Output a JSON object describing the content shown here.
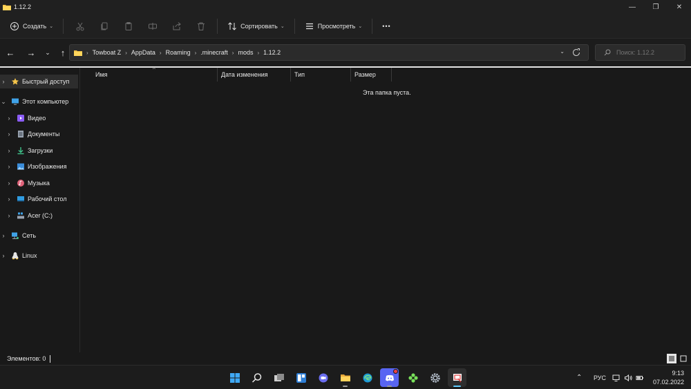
{
  "window": {
    "title": "1.12.2",
    "controls": {
      "minimize": "—",
      "maximize": "❐",
      "close": "✕"
    }
  },
  "commandbar": {
    "create_label": "Создать",
    "sort_label": "Сортировать",
    "view_label": "Просмотреть",
    "more_label": "•••",
    "icons": [
      "cut-icon",
      "copy-icon",
      "paste-icon",
      "rename-icon",
      "share-icon",
      "delete-icon"
    ]
  },
  "address": {
    "crumbs": [
      "Towboat Z",
      "AppData",
      "Roaming",
      ".minecraft",
      "mods",
      "1.12.2"
    ],
    "search_placeholder": "Поиск: 1.12.2"
  },
  "sidebar": {
    "items": [
      {
        "label": "Быстрый доступ",
        "icon": "star-icon"
      },
      {
        "label": "Этот компьютер",
        "icon": "computer-icon"
      },
      {
        "label": "Видео",
        "icon": "video-icon"
      },
      {
        "label": "Документы",
        "icon": "documents-icon"
      },
      {
        "label": "Загрузки",
        "icon": "downloads-icon"
      },
      {
        "label": "Изображения",
        "icon": "pictures-icon"
      },
      {
        "label": "Музыка",
        "icon": "music-icon"
      },
      {
        "label": "Рабочий стол",
        "icon": "desktop-icon"
      },
      {
        "label": "Acer (C:)",
        "icon": "drive-icon"
      },
      {
        "label": "Сеть",
        "icon": "network-icon"
      },
      {
        "label": "Linux",
        "icon": "linux-icon"
      }
    ]
  },
  "content": {
    "columns": [
      "Имя",
      "Дата изменения",
      "Тип",
      "Размер"
    ],
    "empty_message": "Эта папка пуста."
  },
  "status": {
    "items_count": "Элементов: 0"
  },
  "taskbar": {
    "language": "РУС",
    "time": "9:13",
    "date": "07.02.2022",
    "apps": [
      "start-icon",
      "search-icon",
      "task-view-icon",
      "widgets-icon",
      "chat-icon",
      "file-explorer-icon",
      "edge-icon",
      "discord-icon",
      "game-icon",
      "settings-icon",
      "snipping-tool-icon"
    ]
  },
  "colors": {
    "background": "#191919",
    "chrome": "#202020",
    "folder": "#f3c34a",
    "accent": "#60cdff"
  }
}
